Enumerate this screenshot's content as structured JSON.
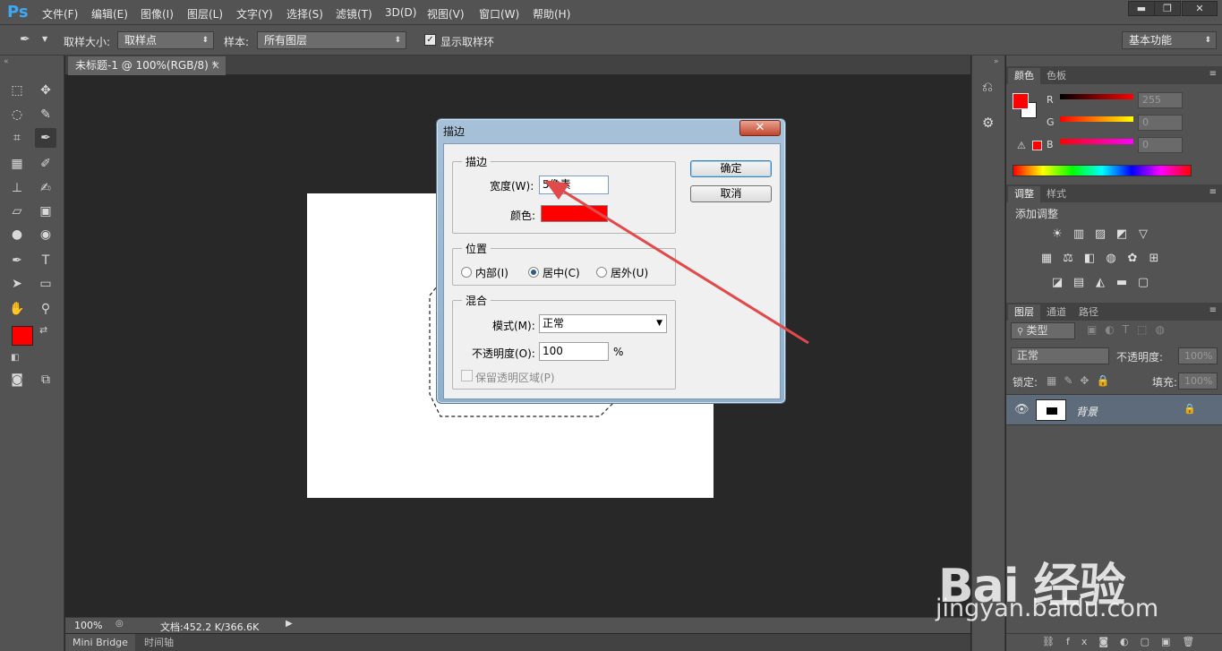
{
  "app": {
    "logo": "Ps"
  },
  "menu": [
    "文件(F)",
    "编辑(E)",
    "图像(I)",
    "图层(L)",
    "文字(Y)",
    "选择(S)",
    "滤镜(T)",
    "3D(D)",
    "视图(V)",
    "窗口(W)",
    "帮助(H)"
  ],
  "window_controls": {
    "minimize": "▬",
    "restore": "❐",
    "close": "✕"
  },
  "options": {
    "sample_size_label": "取样大小:",
    "sample_size_value": "取样点",
    "sample_label": "样本:",
    "sample_value": "所有图层",
    "show_ring_label": "显示取样环",
    "show_ring_checked": true,
    "workspace": "基本功能"
  },
  "document": {
    "tab_title": "未标题-1 @ 100%(RGB/8) *",
    "tab_close": "×",
    "zoom": "100%",
    "doc_size": "文档:452.2 K/366.6K"
  },
  "bottom_tabs": [
    "Mini Bridge",
    "时间轴"
  ],
  "colors": {
    "foreground": "#ff0000",
    "background": "#ffffff",
    "dialog_stroke_color": "#ff0000",
    "arrow": "#e04a4a"
  },
  "color_panel": {
    "tabs": [
      "颜色",
      "色板"
    ],
    "channels": [
      {
        "label": "R",
        "value": "255"
      },
      {
        "label": "G",
        "value": "0"
      },
      {
        "label": "B",
        "value": "0"
      }
    ]
  },
  "adjust_panel": {
    "tabs": [
      "调整",
      "样式"
    ],
    "title": "添加调整"
  },
  "layers_panel": {
    "tabs": [
      "图层",
      "通道",
      "路径"
    ],
    "filter_kind": "类型",
    "blend_mode": "正常",
    "opacity_label": "不透明度:",
    "opacity_value": "100%",
    "lock_label": "锁定:",
    "fill_label": "填充:",
    "fill_value": "100%",
    "layers": [
      {
        "name": "背景",
        "visible": true,
        "locked": true
      }
    ]
  },
  "dialog": {
    "title": "描边",
    "close": "✕",
    "stroke_group": "描边",
    "width_label": "宽度(W):",
    "width_value": "5像素",
    "color_label": "颜色:",
    "ok": "确定",
    "cancel": "取消",
    "position_group": "位置",
    "positions": [
      "内部(I)",
      "居中(C)",
      "居外(U)"
    ],
    "position_selected": "居中(C)",
    "blend_group": "混合",
    "mode_label": "模式(M):",
    "mode_value": "正常",
    "opacity_label": "不透明度(O):",
    "opacity_value": "100",
    "opacity_unit": "%",
    "preserve_label": "保留透明区域(P)",
    "preserve_checked": false
  },
  "watermark": {
    "main": "Bai 经验",
    "sub": "jingyan.baidu.com"
  }
}
